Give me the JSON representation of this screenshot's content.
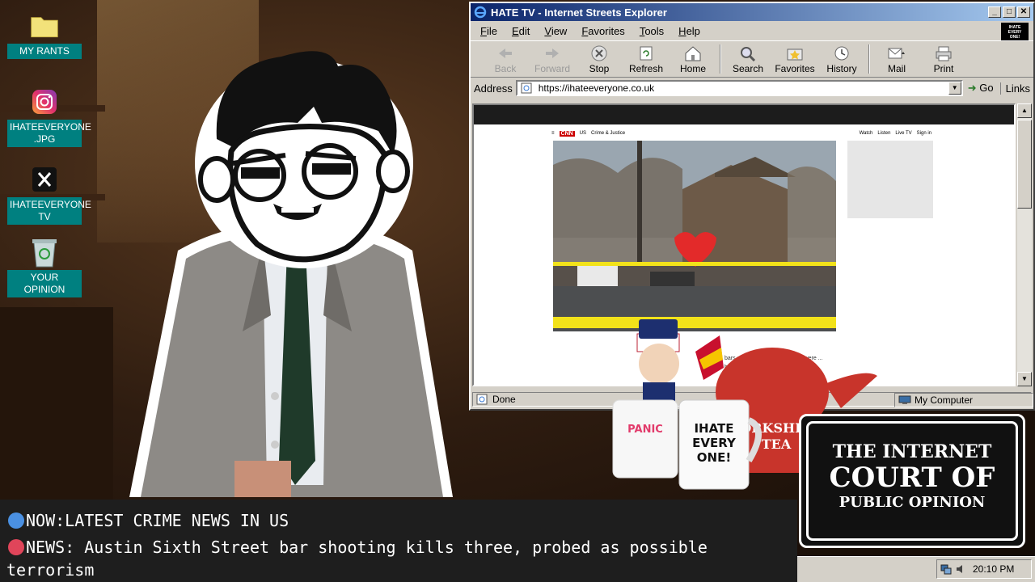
{
  "desktop": {
    "icons": [
      {
        "label": "MY RANTS",
        "icon": "folder-icon"
      },
      {
        "label": "IHATEEVERYONE .JPG",
        "icon": "instagram-icon"
      },
      {
        "label": "IHATEEVERYONE TV",
        "icon": "x-logo-icon"
      },
      {
        "label": "YOUR OPINION",
        "icon": "recycle-bin-icon"
      }
    ]
  },
  "browser": {
    "title": "HATE TV - Internet Streets Explorer",
    "menu": [
      "File",
      "Edit",
      "View",
      "Favorites",
      "Tools",
      "Help"
    ],
    "logo_text": "IHATE EVERY ONE!",
    "toolbar": {
      "back": "Back",
      "forward": "Forward",
      "stop": "Stop",
      "refresh": "Refresh",
      "home": "Home",
      "search": "Search",
      "favorites": "Favorites",
      "history": "History",
      "mail": "Mail",
      "print": "Print"
    },
    "address_label": "Address",
    "url": "https://ihateeveryone.co.uk",
    "go_label": "Go",
    "links_label": "Links",
    "status_left": "Done",
    "status_zone": "My Computer"
  },
  "news_page": {
    "brand": "CNN",
    "region": "US",
    "section": "Crime & Justice",
    "nav_right": [
      "Watch",
      "Listen",
      "Live TV",
      "Sign in"
    ],
    "article_snippet": "bars along Austin's Sixth Street were ... barrage of ... the popular"
  },
  "merch": {
    "mug_text": "IHATE EVERY ONE!",
    "tea_text": "YORKSHIRE TEA"
  },
  "ticker": {
    "line1": "NOW:LATEST CRIME NEWS IN US",
    "line2": "NEWS: Austin Sixth Street bar shooting kills three, probed as possible",
    "line3": "terrorism",
    "dot1_color": "#4a90e2",
    "dot2_color": "#e0455a"
  },
  "court_sign": {
    "line1": "THE INTERNET",
    "line2": "COURT OF",
    "line3": "PUBLIC OPINION"
  },
  "tray": {
    "time": "20:10 PM"
  }
}
